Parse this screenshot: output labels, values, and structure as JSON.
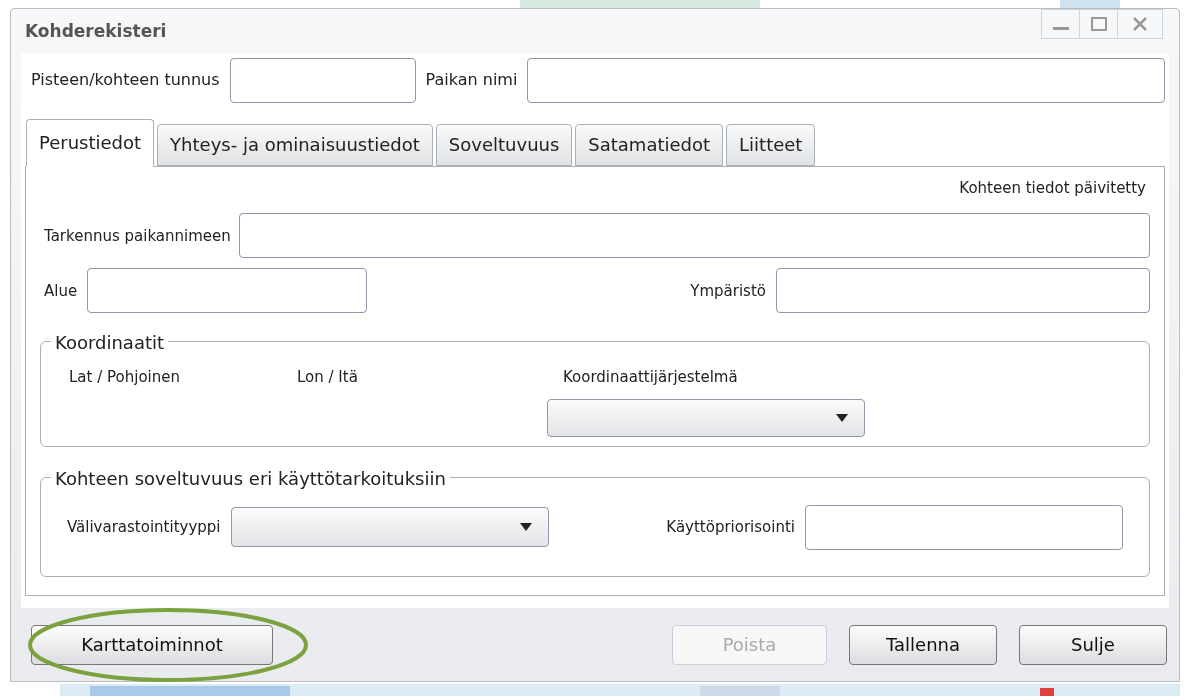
{
  "window": {
    "title": "Kohderekisteri"
  },
  "header_fields": [
    {
      "label": "Pisteen/kohteen tunnus"
    },
    {
      "label": "Paikan nimi"
    }
  ],
  "tabs": [
    {
      "label": "Perustiedot",
      "selected": true
    },
    {
      "label": "Yhteys- ja ominaisuustiedot",
      "selected": false
    },
    {
      "label": "Soveltuvuus",
      "selected": false
    },
    {
      "label": "Satamatiedot",
      "selected": false
    },
    {
      "label": "Liitteet",
      "selected": false
    }
  ],
  "status_text": "Kohteen tiedot päivitetty",
  "refinement_field": {
    "label": "Tarkennus paikannimeen"
  },
  "area_field": {
    "label": "Alue"
  },
  "environment_field": {
    "label": "Ympäristö"
  },
  "coordinates": {
    "legend": "Koordinaatit",
    "lat_label": "Lat / Pohjoinen",
    "lon_label": "Lon / Itä",
    "system_label": "Koordinaattijärjestelmä"
  },
  "suitability": {
    "legend": "Kohteen soveltuvuus eri käyttötarkoituksiin",
    "storage_label": "Välivarastointityyppi",
    "priority_label": "Käyttöpriorisointi"
  },
  "buttons": [
    {
      "label": "Karttatoiminnot",
      "disabled": false,
      "highlighted": true
    },
    {
      "label": "Poista",
      "disabled": true,
      "highlighted": false
    },
    {
      "label": "Tallenna",
      "disabled": false,
      "highlighted": false
    },
    {
      "label": "Sulje",
      "disabled": false,
      "highlighted": false
    }
  ]
}
